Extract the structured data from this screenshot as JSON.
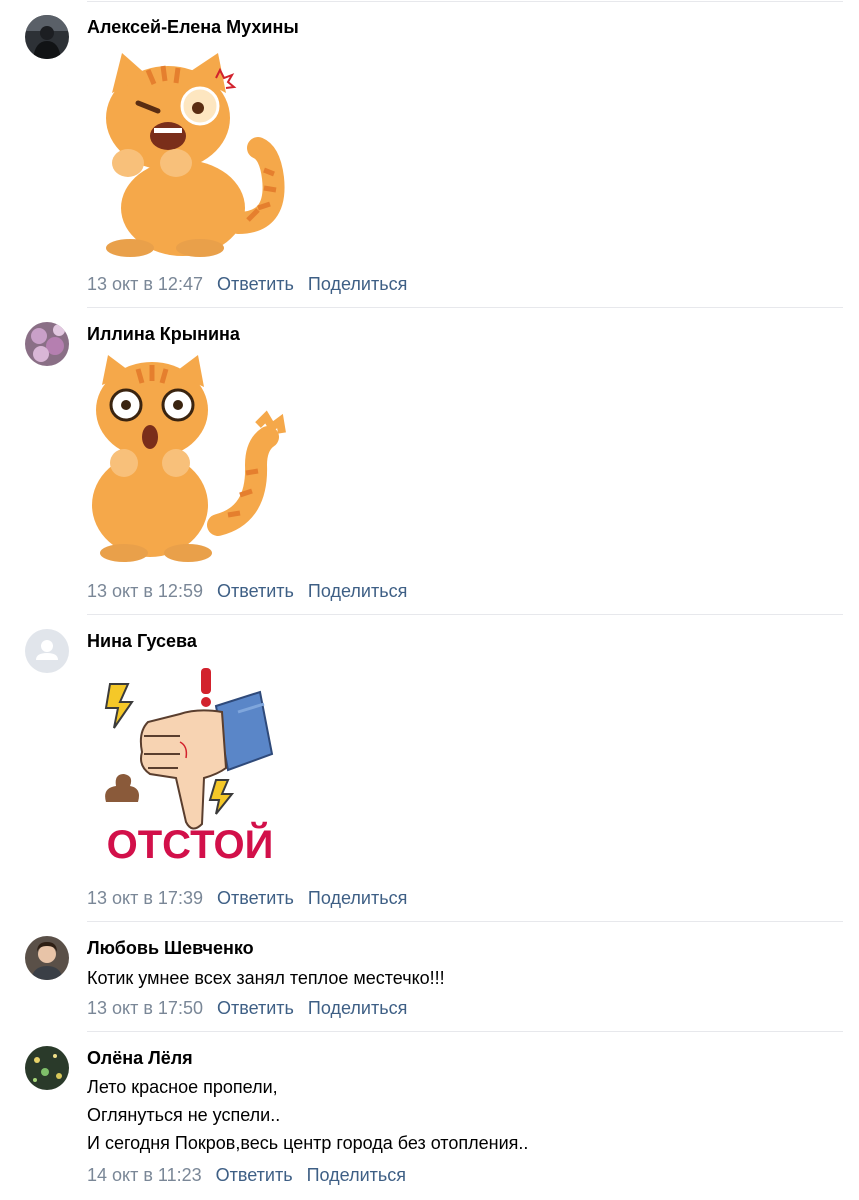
{
  "comments": [
    {
      "author": "Алексей-Елена Мухины",
      "date": "13 окт в 12:47",
      "reply": "Ответить",
      "share": "Поделиться",
      "sticker": "angry-cat-sticker"
    },
    {
      "author": "Иллина Крынина",
      "date": "13 окт в 12:59",
      "reply": "Ответить",
      "share": "Поделиться",
      "sticker": "shocked-cat-sticker"
    },
    {
      "author": "Нина Гусева",
      "date": "13 окт в 17:39",
      "reply": "Ответить",
      "share": "Поделиться",
      "sticker": "thumbs-down-sticker",
      "sticker_text": "ОТСТОЙ"
    },
    {
      "author": "Любовь Шевченко",
      "text": "Котик умнее всех занял теплое местечко!!!",
      "date": "13 окт в 17:50",
      "reply": "Ответить",
      "share": "Поделиться"
    },
    {
      "author": "Олёна Лёля",
      "lines": [
        "Лето красное пропели,",
        "Оглянуться не успели..",
        "И сегодня Покров,весь центр города без отопления.."
      ],
      "date": "14 окт в 11:23",
      "reply": "Ответить",
      "share": "Поделиться"
    }
  ],
  "colors": {
    "date": "#7a8797",
    "link": "#3e5f85",
    "separator": "#e7e8ec",
    "cat_orange": "#f5a84a",
    "cat_stripe": "#e57f2e"
  }
}
